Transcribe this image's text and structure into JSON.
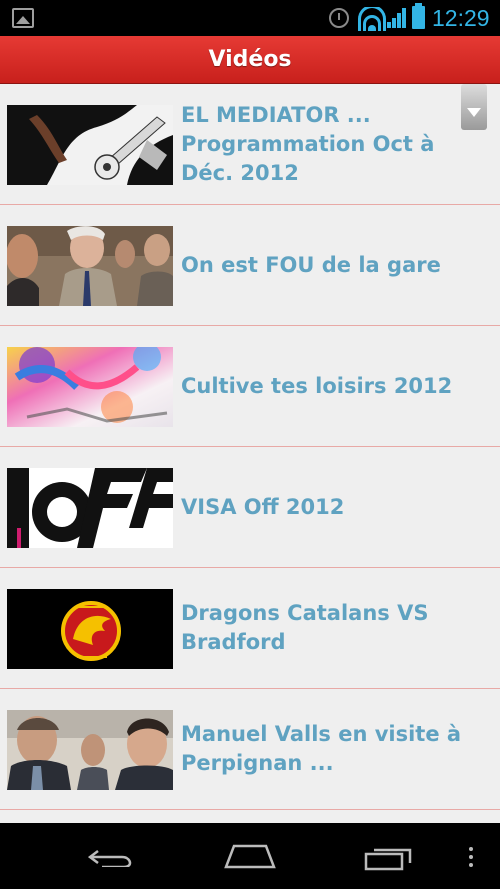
{
  "status_bar": {
    "time": "12:29",
    "icons": [
      "gallery-icon",
      "alarm-icon",
      "wifi-icon",
      "signal-icon",
      "battery-icon"
    ]
  },
  "header": {
    "title": "Vidéos"
  },
  "videos": [
    {
      "title": "EL MEDIATOR ... Programmation Oct à Déc. 2012",
      "thumbnail": "guitar-illustration-thumbnail"
    },
    {
      "title": "On est FOU de la gare",
      "thumbnail": "crowd-people-thumbnail"
    },
    {
      "title": "Cultive tes loisirs 2012",
      "thumbnail": "colorful-letters-thumbnail"
    },
    {
      "title": "VISA Off 2012",
      "thumbnail": "off-logo-thumbnail"
    },
    {
      "title": "Dragons Catalans VS Bradford",
      "thumbnail": "dragons-catalans-logo-thumbnail"
    },
    {
      "title": "Manuel Valls en visite à Perpignan ...",
      "thumbnail": "politicians-thumbnail"
    }
  ],
  "nav_bar": {
    "icons": [
      "back-icon",
      "home-icon",
      "recents-icon",
      "menu-icon"
    ]
  },
  "colors": {
    "accent": "#33b5e5",
    "header_red": "#d62b26",
    "item_text": "#5fa2c1",
    "divider": "#e8a9a6",
    "list_bg": "#efefef"
  }
}
